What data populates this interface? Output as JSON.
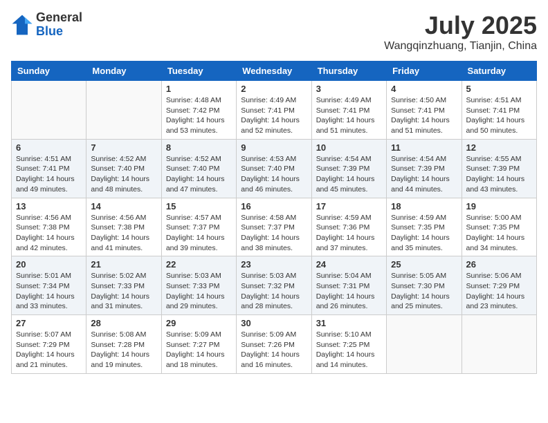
{
  "logo": {
    "general": "General",
    "blue": "Blue"
  },
  "title": {
    "month": "July 2025",
    "location": "Wangqinzhuang, Tianjin, China"
  },
  "days_of_week": [
    "Sunday",
    "Monday",
    "Tuesday",
    "Wednesday",
    "Thursday",
    "Friday",
    "Saturday"
  ],
  "weeks": [
    [
      {
        "day": "",
        "sunrise": "",
        "sunset": "",
        "daylight": ""
      },
      {
        "day": "",
        "sunrise": "",
        "sunset": "",
        "daylight": ""
      },
      {
        "day": "1",
        "sunrise": "Sunrise: 4:48 AM",
        "sunset": "Sunset: 7:42 PM",
        "daylight": "Daylight: 14 hours and 53 minutes."
      },
      {
        "day": "2",
        "sunrise": "Sunrise: 4:49 AM",
        "sunset": "Sunset: 7:41 PM",
        "daylight": "Daylight: 14 hours and 52 minutes."
      },
      {
        "day": "3",
        "sunrise": "Sunrise: 4:49 AM",
        "sunset": "Sunset: 7:41 PM",
        "daylight": "Daylight: 14 hours and 51 minutes."
      },
      {
        "day": "4",
        "sunrise": "Sunrise: 4:50 AM",
        "sunset": "Sunset: 7:41 PM",
        "daylight": "Daylight: 14 hours and 51 minutes."
      },
      {
        "day": "5",
        "sunrise": "Sunrise: 4:51 AM",
        "sunset": "Sunset: 7:41 PM",
        "daylight": "Daylight: 14 hours and 50 minutes."
      }
    ],
    [
      {
        "day": "6",
        "sunrise": "Sunrise: 4:51 AM",
        "sunset": "Sunset: 7:41 PM",
        "daylight": "Daylight: 14 hours and 49 minutes."
      },
      {
        "day": "7",
        "sunrise": "Sunrise: 4:52 AM",
        "sunset": "Sunset: 7:40 PM",
        "daylight": "Daylight: 14 hours and 48 minutes."
      },
      {
        "day": "8",
        "sunrise": "Sunrise: 4:52 AM",
        "sunset": "Sunset: 7:40 PM",
        "daylight": "Daylight: 14 hours and 47 minutes."
      },
      {
        "day": "9",
        "sunrise": "Sunrise: 4:53 AM",
        "sunset": "Sunset: 7:40 PM",
        "daylight": "Daylight: 14 hours and 46 minutes."
      },
      {
        "day": "10",
        "sunrise": "Sunrise: 4:54 AM",
        "sunset": "Sunset: 7:39 PM",
        "daylight": "Daylight: 14 hours and 45 minutes."
      },
      {
        "day": "11",
        "sunrise": "Sunrise: 4:54 AM",
        "sunset": "Sunset: 7:39 PM",
        "daylight": "Daylight: 14 hours and 44 minutes."
      },
      {
        "day": "12",
        "sunrise": "Sunrise: 4:55 AM",
        "sunset": "Sunset: 7:39 PM",
        "daylight": "Daylight: 14 hours and 43 minutes."
      }
    ],
    [
      {
        "day": "13",
        "sunrise": "Sunrise: 4:56 AM",
        "sunset": "Sunset: 7:38 PM",
        "daylight": "Daylight: 14 hours and 42 minutes."
      },
      {
        "day": "14",
        "sunrise": "Sunrise: 4:56 AM",
        "sunset": "Sunset: 7:38 PM",
        "daylight": "Daylight: 14 hours and 41 minutes."
      },
      {
        "day": "15",
        "sunrise": "Sunrise: 4:57 AM",
        "sunset": "Sunset: 7:37 PM",
        "daylight": "Daylight: 14 hours and 39 minutes."
      },
      {
        "day": "16",
        "sunrise": "Sunrise: 4:58 AM",
        "sunset": "Sunset: 7:37 PM",
        "daylight": "Daylight: 14 hours and 38 minutes."
      },
      {
        "day": "17",
        "sunrise": "Sunrise: 4:59 AM",
        "sunset": "Sunset: 7:36 PM",
        "daylight": "Daylight: 14 hours and 37 minutes."
      },
      {
        "day": "18",
        "sunrise": "Sunrise: 4:59 AM",
        "sunset": "Sunset: 7:35 PM",
        "daylight": "Daylight: 14 hours and 35 minutes."
      },
      {
        "day": "19",
        "sunrise": "Sunrise: 5:00 AM",
        "sunset": "Sunset: 7:35 PM",
        "daylight": "Daylight: 14 hours and 34 minutes."
      }
    ],
    [
      {
        "day": "20",
        "sunrise": "Sunrise: 5:01 AM",
        "sunset": "Sunset: 7:34 PM",
        "daylight": "Daylight: 14 hours and 33 minutes."
      },
      {
        "day": "21",
        "sunrise": "Sunrise: 5:02 AM",
        "sunset": "Sunset: 7:33 PM",
        "daylight": "Daylight: 14 hours and 31 minutes."
      },
      {
        "day": "22",
        "sunrise": "Sunrise: 5:03 AM",
        "sunset": "Sunset: 7:33 PM",
        "daylight": "Daylight: 14 hours and 29 minutes."
      },
      {
        "day": "23",
        "sunrise": "Sunrise: 5:03 AM",
        "sunset": "Sunset: 7:32 PM",
        "daylight": "Daylight: 14 hours and 28 minutes."
      },
      {
        "day": "24",
        "sunrise": "Sunrise: 5:04 AM",
        "sunset": "Sunset: 7:31 PM",
        "daylight": "Daylight: 14 hours and 26 minutes."
      },
      {
        "day": "25",
        "sunrise": "Sunrise: 5:05 AM",
        "sunset": "Sunset: 7:30 PM",
        "daylight": "Daylight: 14 hours and 25 minutes."
      },
      {
        "day": "26",
        "sunrise": "Sunrise: 5:06 AM",
        "sunset": "Sunset: 7:29 PM",
        "daylight": "Daylight: 14 hours and 23 minutes."
      }
    ],
    [
      {
        "day": "27",
        "sunrise": "Sunrise: 5:07 AM",
        "sunset": "Sunset: 7:29 PM",
        "daylight": "Daylight: 14 hours and 21 minutes."
      },
      {
        "day": "28",
        "sunrise": "Sunrise: 5:08 AM",
        "sunset": "Sunset: 7:28 PM",
        "daylight": "Daylight: 14 hours and 19 minutes."
      },
      {
        "day": "29",
        "sunrise": "Sunrise: 5:09 AM",
        "sunset": "Sunset: 7:27 PM",
        "daylight": "Daylight: 14 hours and 18 minutes."
      },
      {
        "day": "30",
        "sunrise": "Sunrise: 5:09 AM",
        "sunset": "Sunset: 7:26 PM",
        "daylight": "Daylight: 14 hours and 16 minutes."
      },
      {
        "day": "31",
        "sunrise": "Sunrise: 5:10 AM",
        "sunset": "Sunset: 7:25 PM",
        "daylight": "Daylight: 14 hours and 14 minutes."
      },
      {
        "day": "",
        "sunrise": "",
        "sunset": "",
        "daylight": ""
      },
      {
        "day": "",
        "sunrise": "",
        "sunset": "",
        "daylight": ""
      }
    ]
  ]
}
